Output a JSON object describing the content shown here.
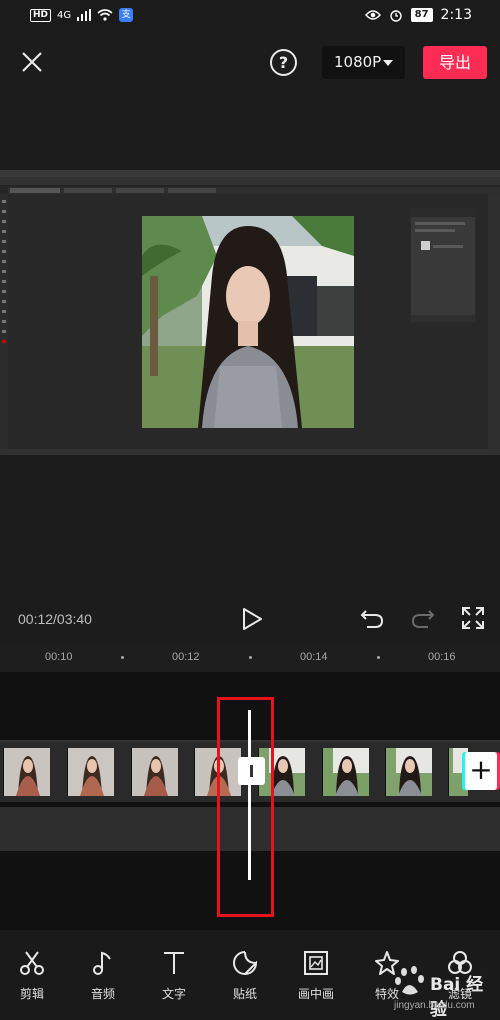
{
  "status_bar": {
    "network": "HD",
    "signal": "4G",
    "battery": "87",
    "time": "2:13"
  },
  "toolbar": {
    "resolution": "1080P",
    "export_label": "导出",
    "help_symbol": "?"
  },
  "player": {
    "timecode": "00:12/03:40"
  },
  "ruler": {
    "ticks": [
      "00:10",
      "00:12",
      "00:14",
      "00:16"
    ]
  },
  "timeline": {
    "add_symbol": "+"
  },
  "bottom_nav": {
    "items": [
      {
        "label": "剪辑",
        "icon": "scissors-icon"
      },
      {
        "label": "音频",
        "icon": "music-note-icon"
      },
      {
        "label": "文字",
        "icon": "text-icon"
      },
      {
        "label": "贴纸",
        "icon": "sticker-icon"
      },
      {
        "label": "画中画",
        "icon": "picture-in-picture-icon"
      },
      {
        "label": "特效",
        "icon": "star-effect-icon"
      },
      {
        "label": "滤镜",
        "icon": "filter-icon"
      }
    ]
  },
  "watermark": {
    "logo": "Bai 经验",
    "url": "jingyan.baidu.com"
  },
  "colors": {
    "export": "#fe2c55",
    "highlight": "#e8121c",
    "background": "#1c1c1c"
  }
}
